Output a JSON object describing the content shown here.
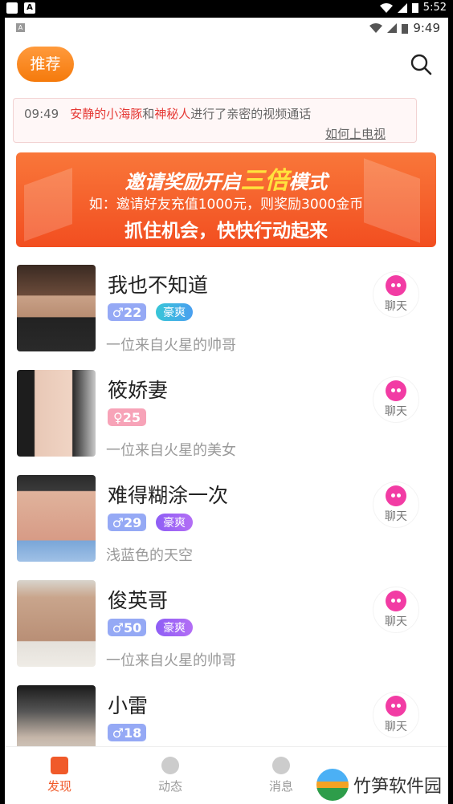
{
  "outer_status": {
    "time": "5:52"
  },
  "inner_status": {
    "time": "9:49"
  },
  "header": {
    "tab_label": "推荐"
  },
  "notice": {
    "time": "09:49",
    "user1": "安静的小海豚",
    "conj": "和",
    "user2": "神秘人",
    "text": "进行了亲密的视频通话",
    "link": "如何上电视"
  },
  "banner": {
    "title_pre": "邀请奖励开启",
    "title_hl": "三倍",
    "title_post": "模式",
    "line2": "如：邀请好友充值1000元，则奖励3000金币",
    "line3": "抓住机会，快快行动起来"
  },
  "users": [
    {
      "name": "我也不知道",
      "gender": "♂",
      "age": "22",
      "vip": "豪爽",
      "vip_color": "teal",
      "bio": "一位来自火星的帅哥",
      "chat": "聊天"
    },
    {
      "name": "筱娇妻",
      "gender": "♀",
      "age": "25",
      "vip": "",
      "vip_color": "",
      "bio": "一位来自火星的美女",
      "chat": "聊天"
    },
    {
      "name": "难得糊涂一次",
      "gender": "♂",
      "age": "29",
      "vip": "豪爽",
      "vip_color": "purple",
      "bio": "浅蓝色的天空",
      "chat": "聊天"
    },
    {
      "name": "俊英哥",
      "gender": "♂",
      "age": "50",
      "vip": "豪爽",
      "vip_color": "purple",
      "bio": "一位来自火星的帅哥",
      "chat": "聊天"
    },
    {
      "name": "小雷",
      "gender": "♂",
      "age": "18",
      "vip": "",
      "vip_color": "",
      "bio": "",
      "chat": "聊天"
    }
  ],
  "tabbar": {
    "discover": "发现",
    "feed": "动态",
    "messages": "消息"
  },
  "watermark": {
    "text": "竹笋软件园"
  },
  "colors": {
    "accent": "#f57a0c",
    "chat": "#f23ca4",
    "male": "#95a9f5",
    "female": "#f7a3b8"
  }
}
